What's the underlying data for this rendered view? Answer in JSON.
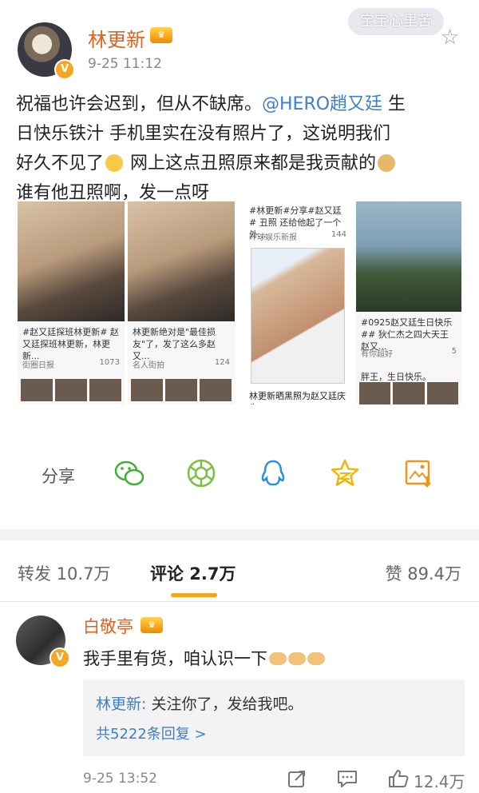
{
  "header": {
    "username": "林更新",
    "time": "9-25 11:12",
    "watermark": "宝宝心里苦",
    "verified_badge": "V",
    "crown_icon": "crown-icon",
    "favorite_icon": "star-outline-icon"
  },
  "post": {
    "line1_prefix": "祝福也许会迟到，但从不缺席。",
    "line1_mention": "@HERO趙又廷",
    "line1_suffix": " 生",
    "line2": "日快乐铁汁    手机里实在没有照片了，这说明我们",
    "line3_a": "好久不见了",
    "line3_b": "  网上这点丑照原来都是我贡献的",
    "line4": "谁有他丑照啊，发一点呀"
  },
  "images": [
    {
      "caption": "#赵又廷探班林更新# 赵又廷探班林更新，林更新...",
      "source": "街圈日报",
      "count": "1073"
    },
    {
      "caption": "林更新绝对是\"最佳损友\"了，发了这么多赵又...",
      "source": "名人街拍",
      "count": "124"
    },
    {
      "top_caption": "#林更新#分享#赵又廷# 丑照 还给他起了一个外...",
      "top_source": "环球娱乐新报",
      "top_count": "144",
      "caption": "林更新晒黑照为赵又廷庆生..."
    },
    {
      "caption": "#0925赵又廷生日快乐## 狄仁杰之四大天王赵又...",
      "source": "有你超好",
      "count": "5",
      "bottom_caption": "胖王，生日快乐。"
    }
  ],
  "share": {
    "label": "分享",
    "icons": [
      "wechat-icon",
      "moments-icon",
      "qq-icon",
      "qzone-icon",
      "save-image-icon"
    ],
    "colors": {
      "wechat": "#3cb034",
      "moments": "#7bc043",
      "qq": "#2a8fd8",
      "qzone": "#f5b400",
      "save": "#f0961c"
    }
  },
  "tabs": [
    {
      "label": "转发 10.7万"
    },
    {
      "label": "评论 2.7万"
    },
    {
      "label": "赞 89.4万"
    }
  ],
  "comment": {
    "name": "白敬亭",
    "text": "我手里有货，咱认识一下",
    "reply_author": "林更新:",
    "reply_text": " 关注你了，发给我吧。",
    "reply_more": "共5222条回复 >",
    "time": "9-25 13:52",
    "likes": "12.4万"
  },
  "colors": {
    "accent": "#f6a21a",
    "username": "#e8601c",
    "link": "#3b7fd0"
  }
}
